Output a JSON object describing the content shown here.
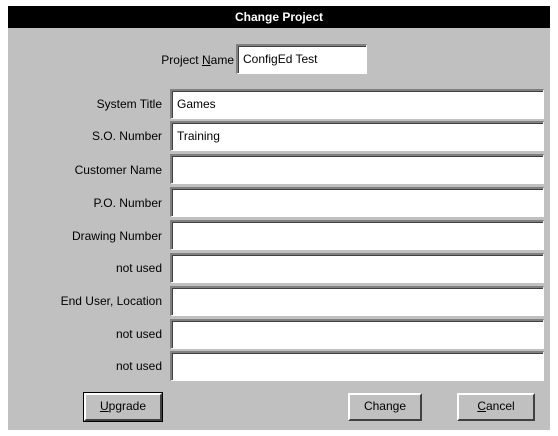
{
  "window": {
    "title": "Change Project"
  },
  "project_name": {
    "label_prefix": "Project ",
    "label_accel": "N",
    "label_suffix": "ame",
    "value": "ConfigEd Test"
  },
  "fields": [
    {
      "label": "System Title",
      "value": "Games"
    },
    {
      "label": "S.O. Number",
      "value": "Training"
    },
    {
      "label": "Customer Name",
      "value": ""
    },
    {
      "label": "P.O. Number",
      "value": ""
    },
    {
      "label": "Drawing Number",
      "value": ""
    },
    {
      "label": "not used",
      "value": ""
    },
    {
      "label": "End User, Location",
      "value": ""
    },
    {
      "label": "not used",
      "value": ""
    },
    {
      "label": "not used",
      "value": ""
    }
  ],
  "buttons": {
    "upgrade": {
      "accel": "U",
      "rest": "pgrade"
    },
    "change": {
      "label": "Change"
    },
    "cancel": {
      "accel": "C",
      "rest": "ancel"
    }
  }
}
